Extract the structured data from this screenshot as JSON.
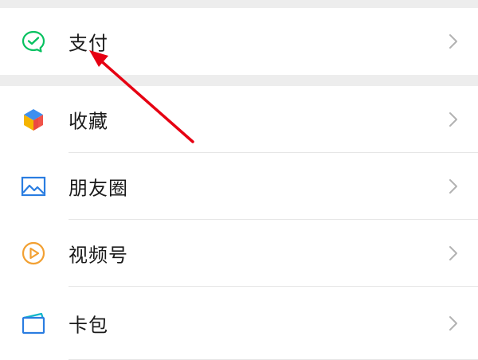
{
  "menu": {
    "pay": {
      "label": "支付",
      "icon": "wechat-pay-icon"
    },
    "items": [
      {
        "label": "收藏",
        "icon": "favorites-cube-icon"
      },
      {
        "label": "朋友圈",
        "icon": "moments-image-icon"
      },
      {
        "label": "视频号",
        "icon": "channels-play-icon"
      },
      {
        "label": "卡包",
        "icon": "card-wallet-icon"
      }
    ]
  },
  "colors": {
    "background": "#ededed",
    "row": "#ffffff",
    "text": "#1a1a1a",
    "chevron": "#b2b2b2",
    "pay_green": "#07c160",
    "annotation_arrow": "#e60012"
  }
}
